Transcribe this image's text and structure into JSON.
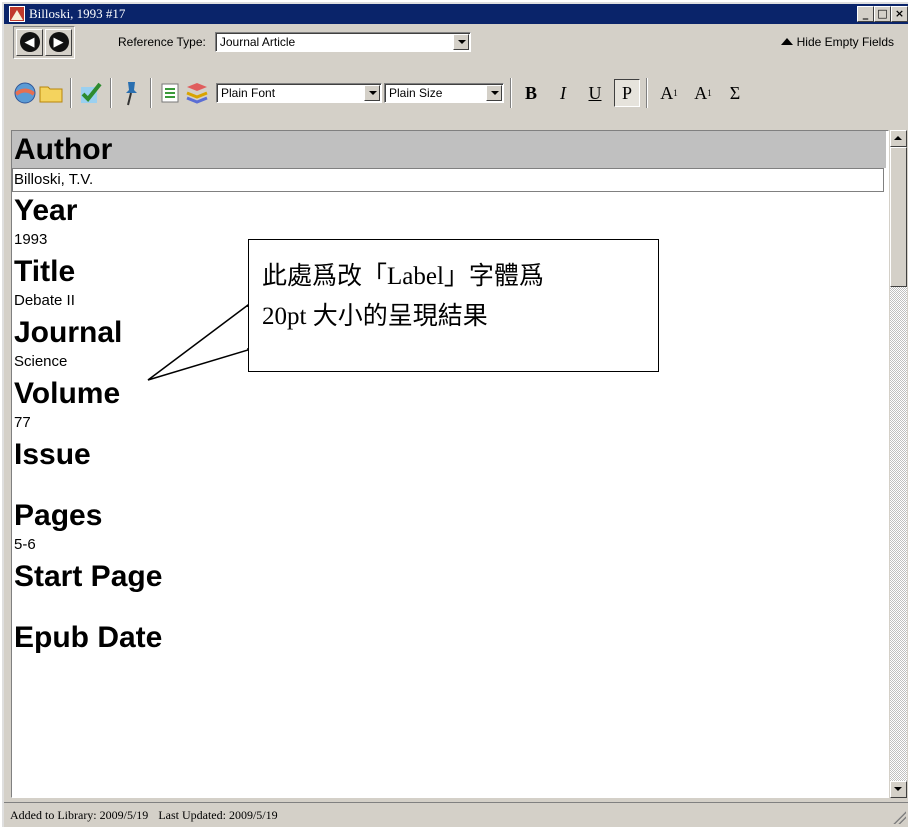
{
  "window": {
    "title": "Billoski, 1993 #17",
    "controls": [
      "_",
      "□",
      "×"
    ]
  },
  "toolbar1": {
    "reference_type_label": "Reference Type:",
    "reference_type_value": "Journal Article",
    "hide_empty_label": "Hide Empty Fields"
  },
  "toolbar2": {
    "font_value": "Plain Font",
    "size_value": "Plain Size",
    "bold": "B",
    "italic": "I",
    "underline": "U",
    "plain": "P",
    "superscript": "A",
    "superscript_mark": "1",
    "subscript": "A",
    "subscript_mark": "1",
    "symbol": "Σ"
  },
  "fields": [
    {
      "label": "Author",
      "value": "Billoski, T.V."
    },
    {
      "label": "Year",
      "value": "1993"
    },
    {
      "label": "Title",
      "value": "Debate II"
    },
    {
      "label": "Journal",
      "value": "Science"
    },
    {
      "label": "Volume",
      "value": "77"
    },
    {
      "label": "Issue",
      "value": ""
    },
    {
      "label": "Pages",
      "value": "5-6"
    },
    {
      "label": "Start Page",
      "value": ""
    },
    {
      "label": "Epub Date",
      "value": ""
    }
  ],
  "status": {
    "added": "Added to Library: 2009/5/19",
    "updated": "Last Updated: 2009/5/19"
  },
  "callout": {
    "line1": "此處爲改「Label」字體爲",
    "line2": "20pt 大小的呈現結果"
  }
}
